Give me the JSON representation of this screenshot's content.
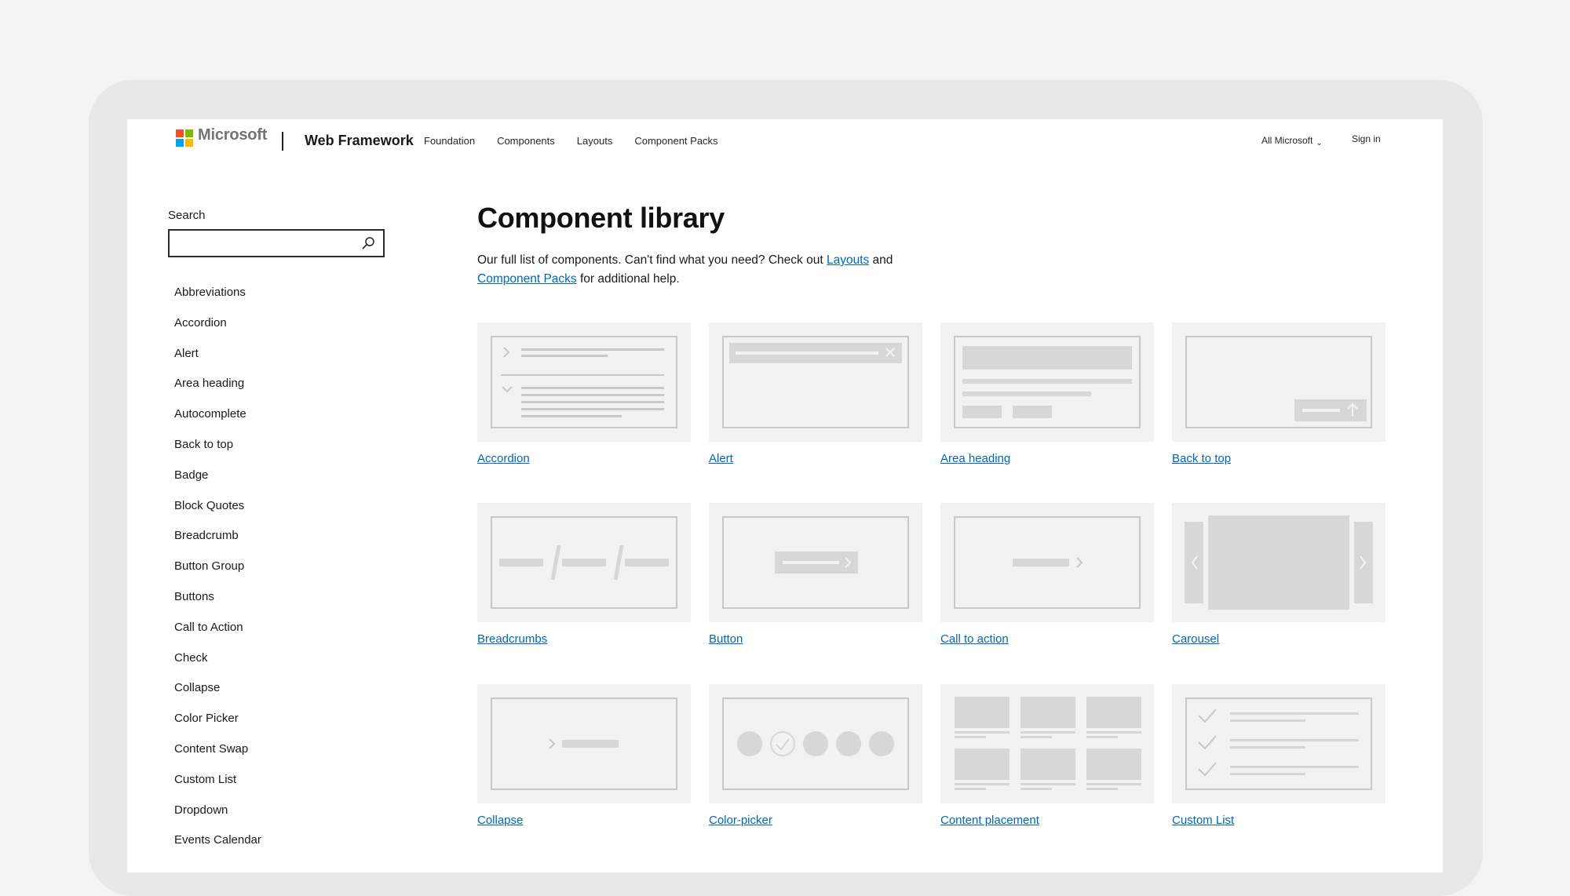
{
  "header": {
    "brand": "Microsoft",
    "site_title": "Web Framework",
    "nav": [
      "Foundation",
      "Components",
      "Layouts",
      "Component Packs"
    ],
    "all_microsoft": "All Microsoft",
    "sign_in": "Sign in"
  },
  "sidebar": {
    "search_label": "Search",
    "search_value": "",
    "items": [
      "Abbreviations",
      "Accordion",
      "Alert",
      "Area heading",
      "Autocomplete",
      "Back to top",
      "Badge",
      "Block Quotes",
      "Breadcrumb",
      "Button Group",
      "Buttons",
      "Call to Action",
      "Check",
      "Collapse",
      "Color Picker",
      "Content Swap",
      "Custom List",
      "Dropdown",
      "Events Calendar"
    ]
  },
  "main": {
    "title": "Component library",
    "intro_before": "Our full list of components. Can't find what you need? Check out ",
    "intro_link1": "Layouts",
    "intro_mid": " and ",
    "intro_link2": "Component Packs",
    "intro_after": " for additional help.",
    "cards": [
      "Accordion",
      "Alert",
      "Area heading",
      "Back to top",
      "Breadcrumbs",
      "Button",
      "Call to action",
      "Carousel",
      "Collapse",
      "Color-picker",
      "Content placement",
      "Custom List"
    ]
  },
  "colors": {
    "link": "#0067b8",
    "thumb_bg": "#f2f2f2",
    "thumb_stroke": "#c8c8c8"
  }
}
